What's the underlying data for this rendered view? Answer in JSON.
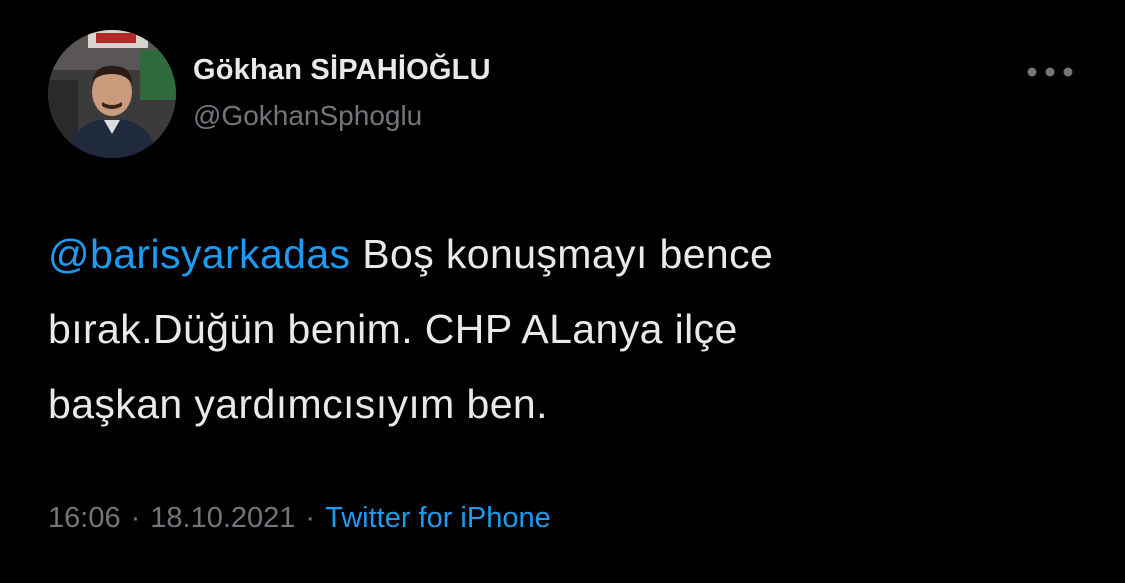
{
  "user": {
    "display_name": "Gökhan SİPAHİOĞLU",
    "handle": "@GokhanSphoglu"
  },
  "tweet": {
    "mention": "@barisyarkadas",
    "line1_rest": " Boş konuşmayı bence",
    "line2": "bırak.Düğün benim. CHP ALanya ilçe",
    "line3": "başkan yardımcısıyım ben."
  },
  "meta": {
    "time": "16:06",
    "date": "18.10.2021",
    "separator": "·",
    "source": "Twitter for iPhone"
  },
  "icons": {
    "more": "more-horizontal-icon"
  },
  "colors": {
    "background": "#000000",
    "text": "#e7e9ea",
    "secondary": "#71767b",
    "accent": "#1d9bf0"
  }
}
